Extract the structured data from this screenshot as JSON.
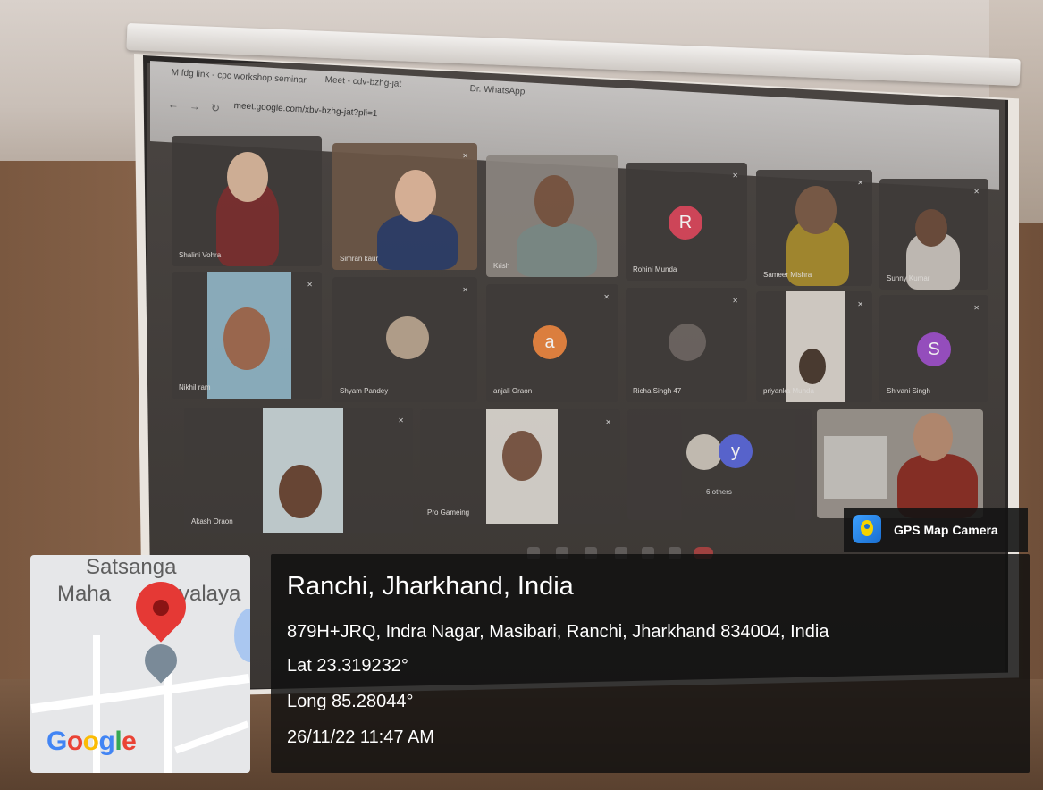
{
  "browser": {
    "tabs": [
      "M  fdg link - cpc workshop seminar",
      "Meet - cdv-bzhg-jat",
      "Dr. WhatsApp"
    ],
    "url": "meet.google.com/xbv-bzhg-jat?pli=1"
  },
  "meeting": {
    "participants": [
      {
        "name": "Shalini Vohra"
      },
      {
        "name": "Simran kaur"
      },
      {
        "name": "Krish"
      },
      {
        "name": "Rohini Munda",
        "initial": "R",
        "color": "#d9465b"
      },
      {
        "name": "Sameer Mishra"
      },
      {
        "name": "Sunny Kumar"
      },
      {
        "name": "Nikhil ram"
      },
      {
        "name": "Shyam Pandey"
      },
      {
        "name": "anjali Oraon",
        "initial": "a",
        "color": "#e8843f"
      },
      {
        "name": "Richa Singh 47"
      },
      {
        "name": "priyanka Munda"
      },
      {
        "name": "Shivani Singh",
        "initial": "S",
        "color": "#9b4fc8"
      },
      {
        "name": "Akash Oraon"
      },
      {
        "name": "Pro Gameing"
      },
      {
        "name": "6 others",
        "initial": "y",
        "color": "#5a67d8"
      }
    ]
  },
  "overlay": {
    "app_name": "GPS Map Camera",
    "location_title": "Ranchi, Jharkhand, India",
    "address": "879H+JRQ, Indra Nagar, Masibari, Ranchi, Jharkhand 834004, India",
    "lat": "Lat 23.319232°",
    "long": "Long 85.28044°",
    "datetime": "26/11/22 11:47 AM"
  },
  "map": {
    "place_line1": "Satsanga",
    "place_line2": "Maha",
    "place_line3": "yalaya",
    "brand": [
      "G",
      "o",
      "o",
      "g",
      "l",
      "e"
    ]
  },
  "colors": {
    "pin": "#e53935",
    "gps_icon": "#1a6ed0",
    "overlay_bg": "#0f0f0f"
  }
}
